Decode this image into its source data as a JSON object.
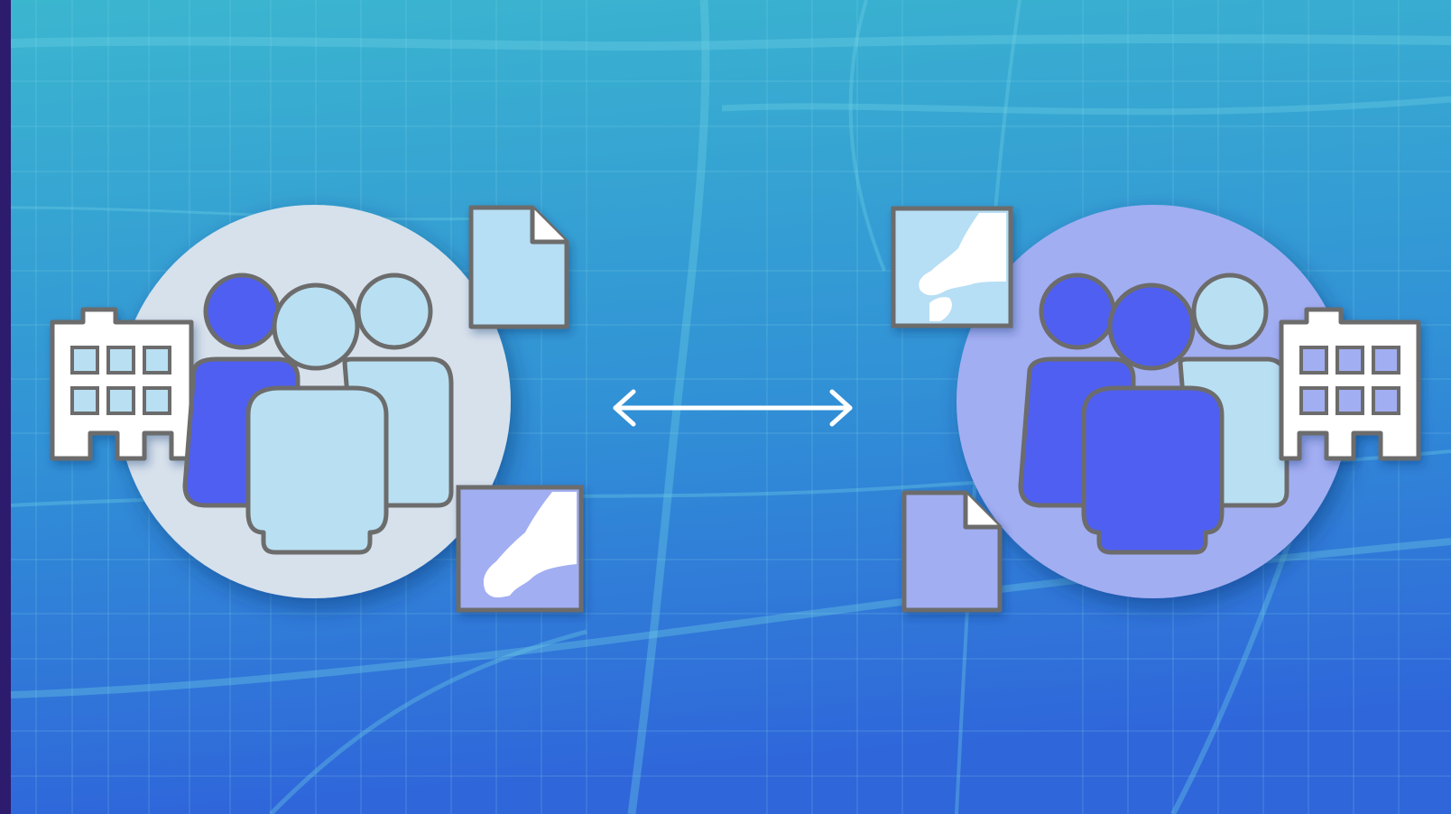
{
  "scene": {
    "description_icons": [
      "building-icon",
      "group-of-people-icon",
      "document-icon",
      "map-tile-icon",
      "bidirectional-arrow-icon"
    ]
  },
  "colors": {
    "background_top": "#3bb4cf",
    "background_bottom": "#2f6bd9",
    "street_lines": "#6fd0e6",
    "left_circle": "#d6e1ec",
    "right_circle": "#a2aef2",
    "person_dark": "#4f5ff2",
    "person_light": "#b9dff2",
    "outline": "#6c6c6c",
    "document_light": "#b6def4",
    "document_purple": "#a2aef2",
    "building_fill": "#ffffff",
    "arrow": "#ffffff",
    "left_edge": "#2d1b6e"
  }
}
